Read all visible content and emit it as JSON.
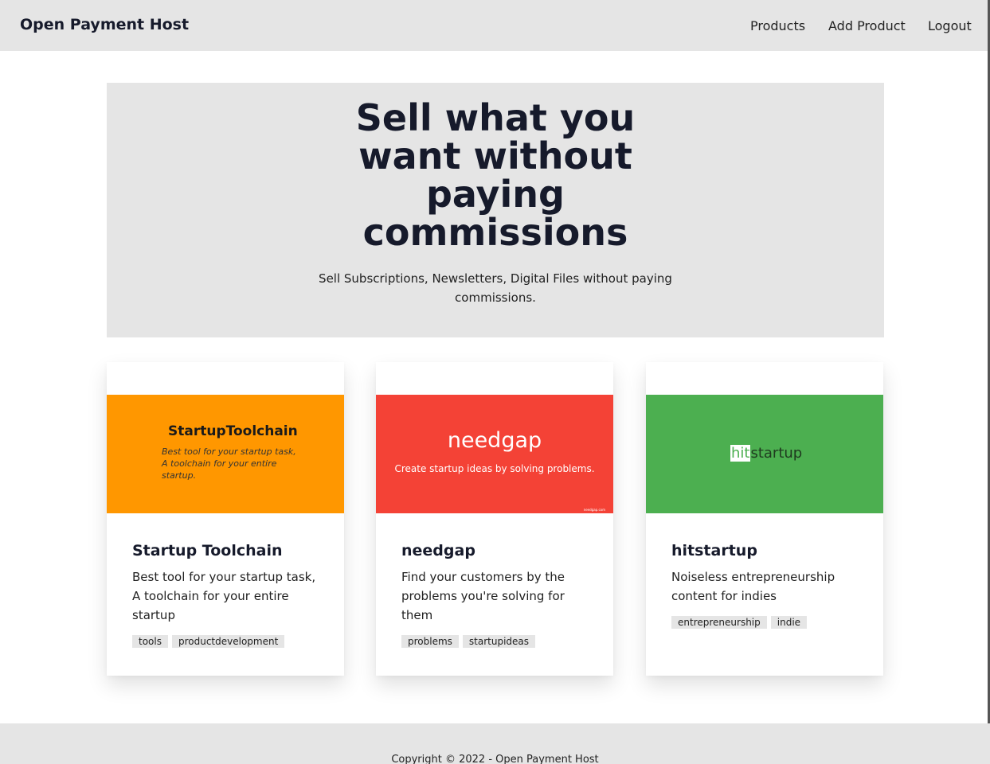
{
  "nav": {
    "brand": "Open Payment Host",
    "links": [
      "Products",
      "Add Product",
      "Logout"
    ]
  },
  "hero": {
    "title": "Sell what you want without paying commissions",
    "subtitle": "Sell Subscriptions, Newsletters, Digital Files without paying commissions."
  },
  "products": [
    {
      "title": "Startup Toolchain",
      "description": "Best tool for your startup task, A toolchain for your entire startup",
      "tags": [
        "tools",
        "productdevelopment"
      ],
      "image": {
        "logo": "StartupToolchain",
        "tagline": "Best tool for your startup task, A toolchain for your entire startup.",
        "bg_color": "#ff9700"
      }
    },
    {
      "title": "needgap",
      "description": "Find your customers by the problems you're solving for them",
      "tags": [
        "problems",
        "startupideas"
      ],
      "image": {
        "logo": "needgap",
        "tagline": "Create startup ideas by solving problems.",
        "url": "needgap.com",
        "bg_color": "#f44236"
      }
    },
    {
      "title": "hitstartup",
      "description": "Noiseless entrepreneurship content for indies",
      "tags": [
        "entrepreneurship",
        "indie"
      ],
      "image": {
        "logo_highlight": "hit",
        "logo_rest": "startup",
        "bg_color": "#4caf50"
      }
    }
  ],
  "footer": {
    "copyright": "Copyright © 2022 - Open Payment Host"
  }
}
